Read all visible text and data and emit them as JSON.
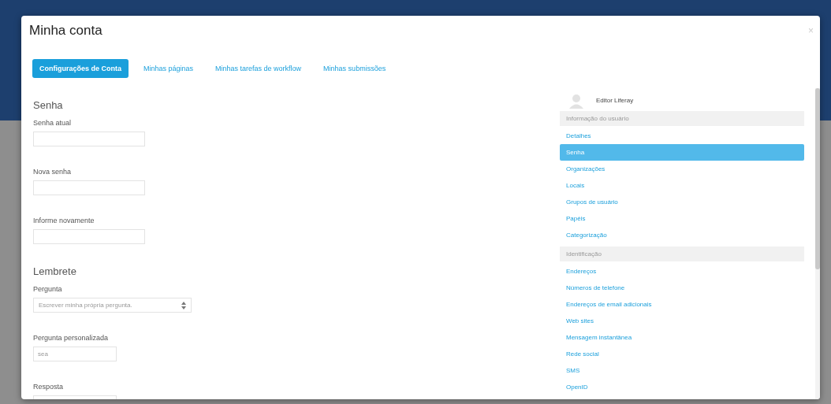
{
  "modal": {
    "title": "Minha conta",
    "close": "×"
  },
  "tabs": [
    {
      "label": "Configurações de Conta",
      "selected": true
    },
    {
      "label": "Minhas páginas",
      "selected": false
    },
    {
      "label": "Minhas tarefas de workflow",
      "selected": false
    },
    {
      "label": "Minhas submissões",
      "selected": false
    }
  ],
  "form": {
    "sections": [
      {
        "title": "Senha",
        "fields": [
          {
            "kind": "text",
            "label": "Senha atual"
          },
          {
            "kind": "text",
            "label": "Nova senha"
          },
          {
            "kind": "text",
            "label": "Informe novamente"
          }
        ]
      },
      {
        "title": "Lembrete",
        "fields": [
          {
            "kind": "select",
            "label": "Pergunta",
            "value": "Escrever minha própria pergunta."
          },
          {
            "kind": "short",
            "label": "Pergunta personalizada",
            "value": "sea"
          },
          {
            "kind": "short",
            "label": "Resposta"
          }
        ]
      }
    ]
  },
  "sidebar": {
    "user": "Editor Liferay",
    "groups": [
      {
        "title": "Informação do usuário",
        "items": [
          {
            "label": "Detalhes",
            "selected": false
          },
          {
            "label": "Senha",
            "selected": true
          },
          {
            "label": "Organizações",
            "selected": false
          },
          {
            "label": "Locais",
            "selected": false
          },
          {
            "label": "Grupos de usuário",
            "selected": false
          },
          {
            "label": "Papéis",
            "selected": false
          },
          {
            "label": "Categorização",
            "selected": false
          }
        ]
      },
      {
        "title": "Identificação",
        "items": [
          {
            "label": "Endereços",
            "selected": false
          },
          {
            "label": "Números de telefone",
            "selected": false
          },
          {
            "label": "Endereços de email adicionais",
            "selected": false
          },
          {
            "label": "Web sites",
            "selected": false
          },
          {
            "label": "Mensagem instantânea",
            "selected": false
          },
          {
            "label": "Rede social",
            "selected": false
          },
          {
            "label": "SMS",
            "selected": false
          },
          {
            "label": "OpenID",
            "selected": false
          }
        ]
      }
    ]
  }
}
